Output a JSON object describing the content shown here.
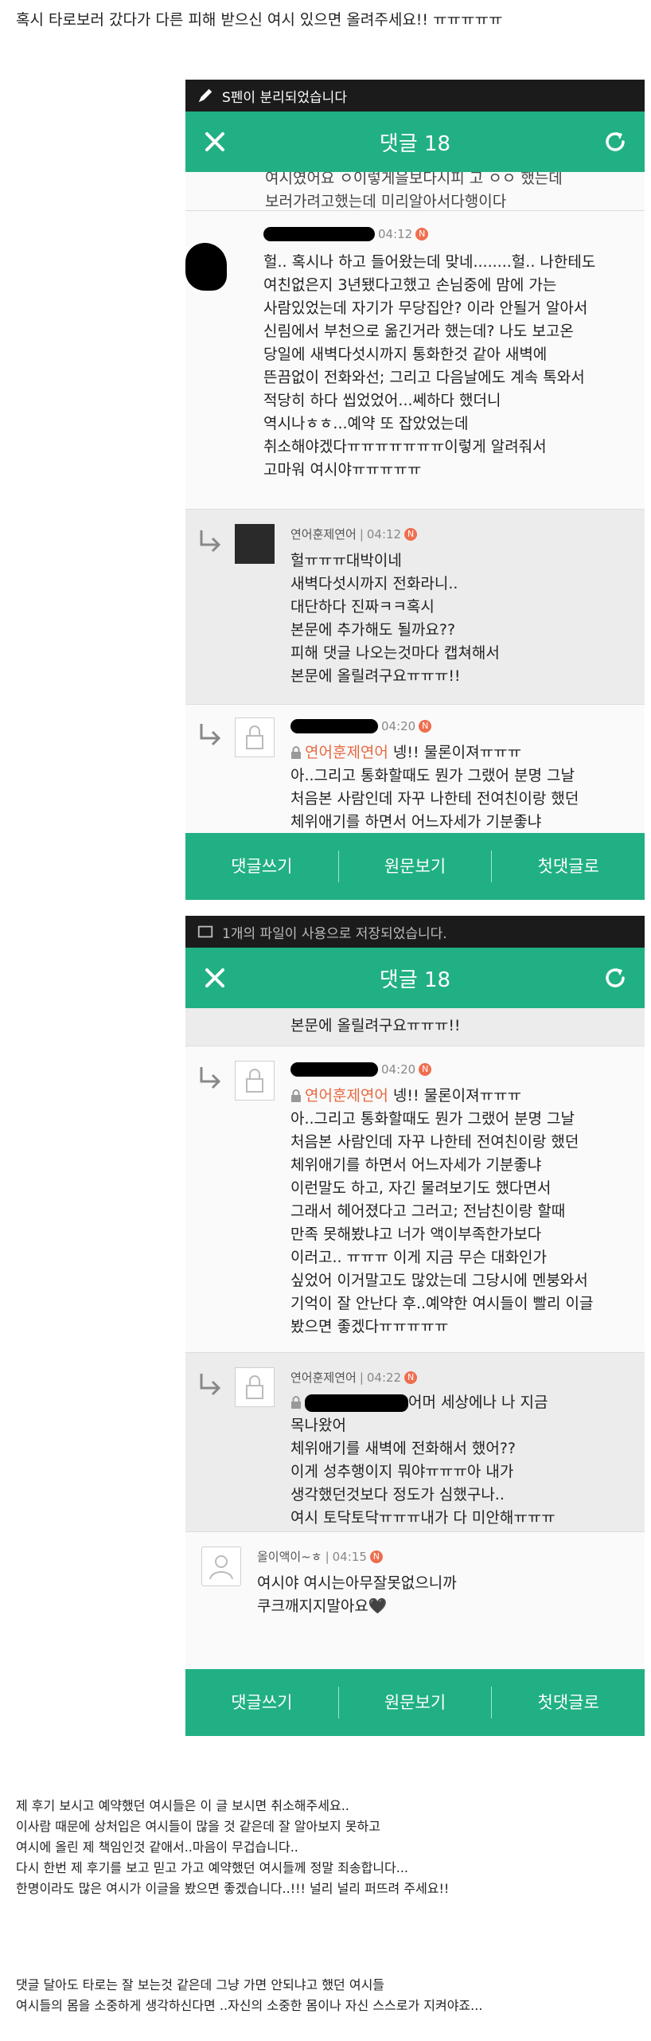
{
  "post_title": "혹시 타로보러 갔다가 다른 피해 받으신 여시 있으면 올려주세요!! ㅠㅠㅠㅠㅠ",
  "screenshot1": {
    "status_text": "S펜이 분리되었습니다",
    "header_title": "댓글 18",
    "top_partial": [
      "여시였어요 ㅇ이렇게을보다시피 고 ㅇㅇ 했는데",
      "보러가려고했는데 미리알아서다행이다"
    ],
    "comment_a": {
      "time": "04:12",
      "badge": "N",
      "lines": [
        "헐.. 혹시나 하고 들어왔는데 맞네........헐.. 나한테도",
        "여친없은지 3년됐다고했고 손님중에 맘에 가는",
        "사람있었는데 자기가 무당집안? 이라 안될거 알아서",
        "신림에서 부천으로 옮긴거라 했는데? 나도 보고온",
        "당일에 새벽다섯시까지 통화한것 같아 새벽에",
        "뜬끔없이 전화와선; 그리고 다음날에도 계속 톡와서",
        "적당히 하다 씹었었어...쎄하다 했더니",
        "역시나ㅎㅎ...예약 또 잡았었는데",
        "취소해야겠다ㅠㅠㅠㅠㅠㅠㅠ이렇게 알려줘서",
        "고마워 여시야ㅠㅠㅠㅠㅠ"
      ]
    },
    "comment_b": {
      "nick": "연어훈제연어",
      "time": "04:12",
      "badge": "N",
      "lines": [
        "헐ㅠㅠㅠ대박이네",
        "새벽다섯시까지 전화라니..",
        "대단하다 진짜ㅋㅋ혹시",
        "본문에 추가해도 될까요??",
        "피해 댓글 나오는것마다 캡쳐해서",
        "본문에 올릴려구요ㅠㅠㅠ!!"
      ]
    },
    "comment_c": {
      "time": "04:20",
      "badge": "N",
      "nick": "연어훈제연어",
      "first_rest": " 넹!! 물론이져ㅠㅠㅠ",
      "lines": [
        "아..그리고 통화할때도 뭔가 그랬어 분명 그날",
        "처음본 사람인데 자꾸 나한테 전여친이랑 했던",
        "체위애기를 하면서 어느자세가 기분좋냐"
      ]
    },
    "bottom": [
      "댓글쓰기",
      "원문보기",
      "첫댓글로"
    ]
  },
  "screenshot2": {
    "status_text": "1개의 파일이 사용으로 저장되었습니다.",
    "header_title": "댓글 18",
    "top_partial": [
      "본문에 올릴려구요ㅠㅠㅠ!!"
    ],
    "comment_c": {
      "time": "04:20",
      "badge": "N",
      "nick": "연어훈제연어",
      "first_rest": " 넹!! 물론이져ㅠㅠㅠ",
      "lines": [
        "아..그리고 통화할때도 뭔가 그랬어 분명 그날",
        "처음본 사람인데 자꾸 나한테 전여친이랑 했던",
        "체위애기를 하면서 어느자세가 기분좋냐",
        "이런말도 하고, 자긴 물려보기도 했다면서",
        "그래서 헤어졌다고 그러고; 전남친이랑 할때",
        "만족 못해봤냐고 너가 액이부족한가보다",
        "이러고.. ㅠㅠㅠ 이게 지금 무슨 대화인가",
        "싶었어 이거말고도 많았는데 그당시에 멘붕와서",
        "기억이 잘 안난다 후..예약한 여시들이 빨리 이글",
        "봤으면 좋겠다ㅠㅠㅠㅠㅠ"
      ]
    },
    "comment_d": {
      "nick": "연어훈제연어",
      "time": "04:22",
      "badge": "N",
      "first_rest": "어머 세상에나 나 지금",
      "lines": [
        "목나왔어",
        "체위애기를 새벽에 전화해서 했어??",
        "이게 성추행이지 뭐야ㅠㅠㅠ아 내가",
        "생각했던것보다 정도가 심했구나..",
        "여시 토닥토닥ㅠㅠㅠ내가 다 미안해ㅠㅠㅠ"
      ]
    },
    "comment_e": {
      "nick": "올이액이~ㅎ",
      "time": "04:15",
      "badge": "N",
      "lines": [
        "여시야 여시는아무잘못없으니까",
        "쿠크깨지지말아요🖤"
      ]
    },
    "bottom": [
      "댓글쓰기",
      "원문보기",
      "첫댓글로"
    ]
  },
  "notice1": [
    "제 후기 보시고 예약했던 여시들은 이 글 보시면 취소해주세요..",
    "이사람 때문에 상처입은 여시들이 많을 것 같은데 잘 알아보지 못하고",
    "여시에 올린 제 책임인것 같애서..마음이 무겁습니다..",
    "다시 한번 제 후기를 보고 믿고 가고 예약했던 여시들께 정말 죄송합니다...",
    "한명이라도 많은 여시가 이글을 봤으면 좋겠습니다..!!! 널리 널리 퍼뜨려 주세요!!"
  ],
  "notice2": [
    "댓글 달아도 타로는 잘 보는것 같은데 그냥 가면 안되냐고 했던 여시들",
    "여시들의 몸을 소중하게 생각하신다면 ..자신의 소중한 몸이나 자신 스스로가 지켜야죠..."
  ]
}
